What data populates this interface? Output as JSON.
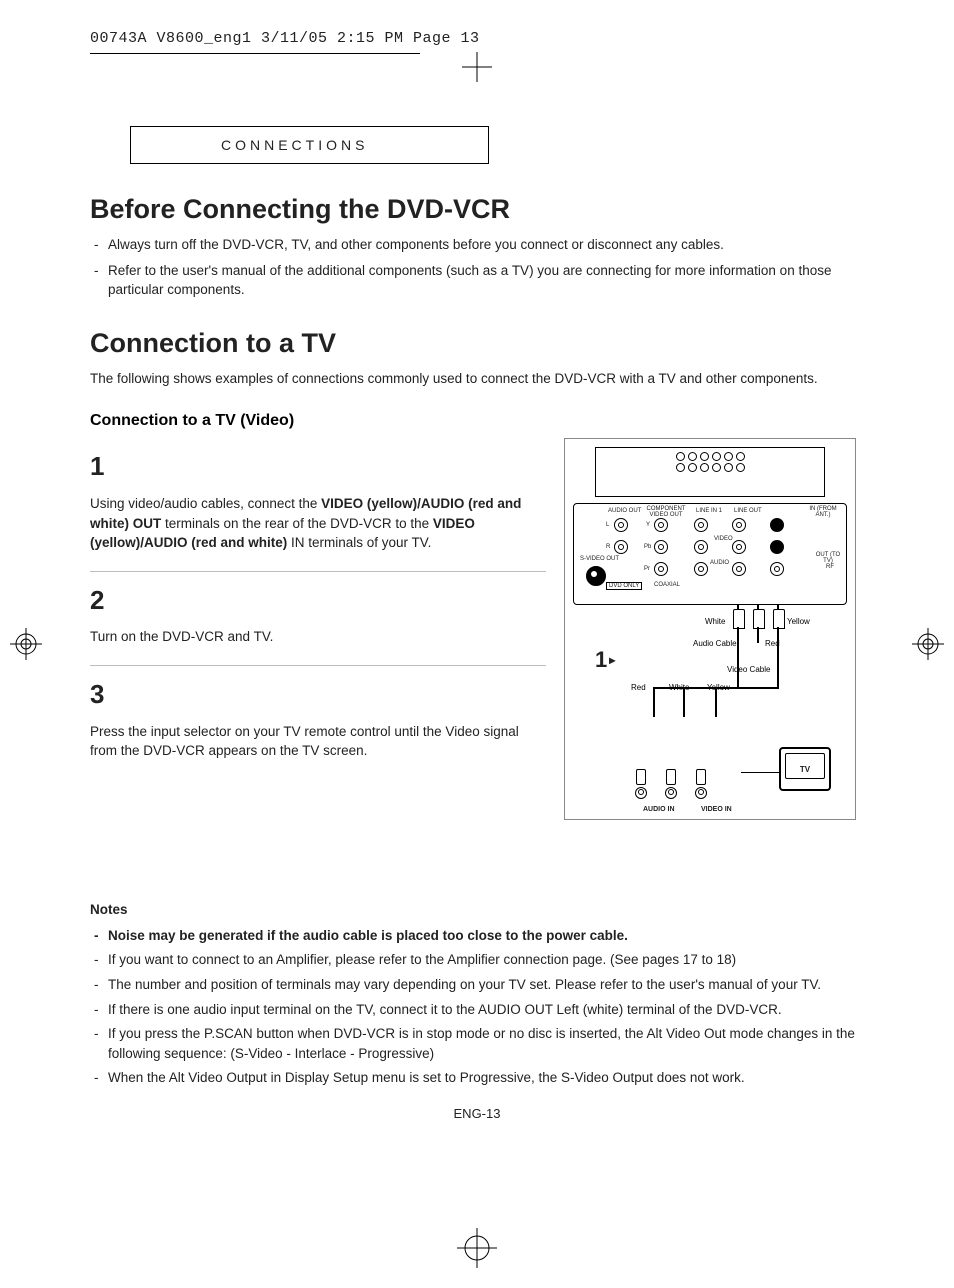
{
  "header": {
    "print_line": "00743A V8600_eng1  3/11/05  2:15 PM  Page 13"
  },
  "section_tab": "CONNECTIONS",
  "h1_before": "Before Connecting the DVD-VCR",
  "before_bullets": [
    "Always turn off the DVD-VCR, TV, and other components before you connect or disconnect any cables.",
    "Refer to the user's manual of the additional components (such as a TV) you are connecting for more information on those particular components."
  ],
  "h1_connection": "Connection to a TV",
  "connection_intro": "The following shows examples of connections commonly used to connect the DVD-VCR with a TV and other components.",
  "sub_heading": "Connection to a TV (Video)",
  "steps": [
    {
      "num": "1",
      "pre": "Using video/audio cables, connect the ",
      "bold1": "VIDEO (yellow)/AUDIO (red and white) OUT",
      "mid": " terminals on the rear of the DVD-VCR to the ",
      "bold2": "VIDEO (yellow)/AUDIO (red and white)",
      "post": " IN terminals of your TV."
    },
    {
      "num": "2",
      "text": "Turn on the DVD-VCR and TV."
    },
    {
      "num": "3",
      "text": "Press the input selector on your TV remote control until the Video signal from the DVD-VCR appears on the TV screen."
    }
  ],
  "diagram": {
    "labels": {
      "audio_out": "AUDIO OUT",
      "component": "COMPONENT VIDEO OUT",
      "line_in1": "LINE IN 1",
      "line_out": "LINE OUT",
      "in_from_ant": "IN (FROM ANT.)",
      "out_to_tv": "OUT (TO TV)",
      "rf": "RF",
      "svideo": "S-VIDEO OUT",
      "dvd_only": "DVD ONLY",
      "video": "VIDEO",
      "audio": "AUDIO",
      "coaxial": "COAXIAL",
      "white": "White",
      "yellow": "Yellow",
      "red": "Red",
      "audio_cable": "Audio Cable",
      "video_cable": "Video Cable",
      "tv": "TV",
      "audio_in": "AUDIO IN",
      "video_in": "VIDEO IN",
      "l": "L",
      "r": "R",
      "y": "Y",
      "pb": "Pb",
      "pr": "Pr"
    },
    "big_step_ref": "1"
  },
  "notes": {
    "title": "Notes",
    "items": [
      {
        "bold": true,
        "text": "Noise may be generated if the audio cable is placed too close to the power cable."
      },
      {
        "bold": false,
        "text": "If you want to connect to an Amplifier, please refer to the Amplifier connection page. (See pages 17 to 18)"
      },
      {
        "bold": false,
        "text": "The number and position of terminals may vary depending on your TV set. Please refer to the user's manual of your TV."
      },
      {
        "bold": false,
        "text": "If there is one audio input terminal on the TV, connect it to the AUDIO OUT Left (white) terminal of the DVD-VCR."
      },
      {
        "bold": false,
        "text": "If you press the P.SCAN button when DVD-VCR is in stop mode or no disc is inserted, the Alt Video Out mode changes in the following sequence: (S-Video - Interlace - Progressive)"
      },
      {
        "bold": false,
        "text": "When the Alt Video Output in Display Setup menu is set to Progressive, the S-Video Output does not work."
      }
    ]
  },
  "page_number": "ENG-13"
}
